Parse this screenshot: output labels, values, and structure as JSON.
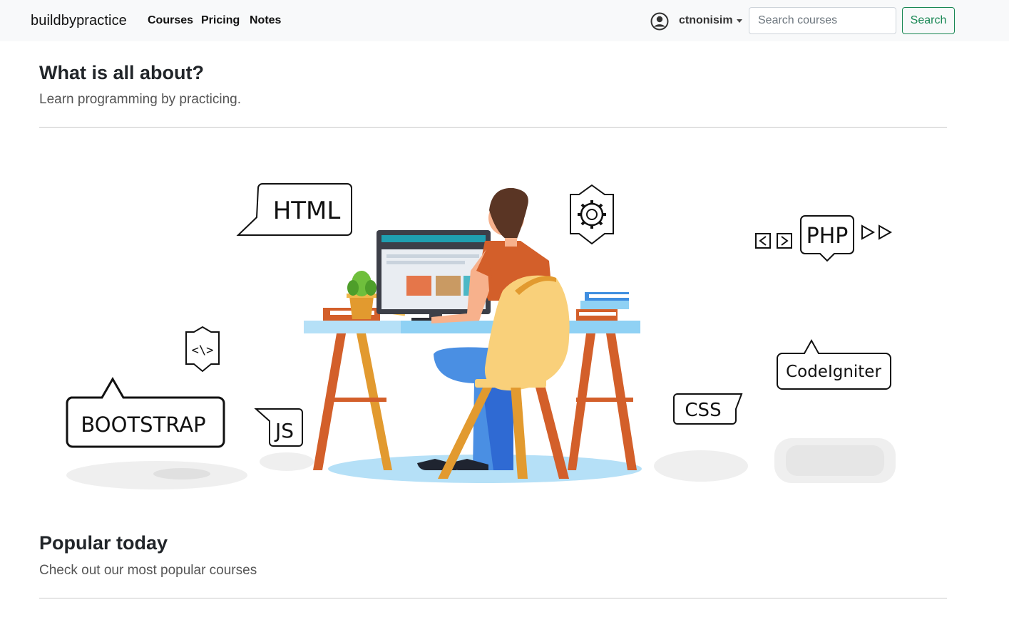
{
  "navbar": {
    "brand": "buildbypractice",
    "links": [
      {
        "label": "Courses"
      },
      {
        "label": "Pricing"
      },
      {
        "label": "Notes"
      }
    ],
    "user": {
      "name": "ctnonisim",
      "icon": "user-circle-icon"
    },
    "search": {
      "placeholder": "Search courses",
      "button_label": "Search"
    }
  },
  "about": {
    "title": "What is all about?",
    "subtitle": "Learn programming by practicing."
  },
  "illustration": {
    "bubbles": [
      "HTML",
      "PHP",
      "BOOTSTRAP",
      "JS",
      "CSS",
      "CodeIgniter"
    ]
  },
  "popular": {
    "title": "Popular today",
    "subtitle": "Check out our most popular courses"
  },
  "colors": {
    "accent": "#198754",
    "navbar_bg": "#f8f9fa",
    "shirt": "#d35f2a",
    "chair": "#f9d07a",
    "desk": "#8fd1f4"
  }
}
